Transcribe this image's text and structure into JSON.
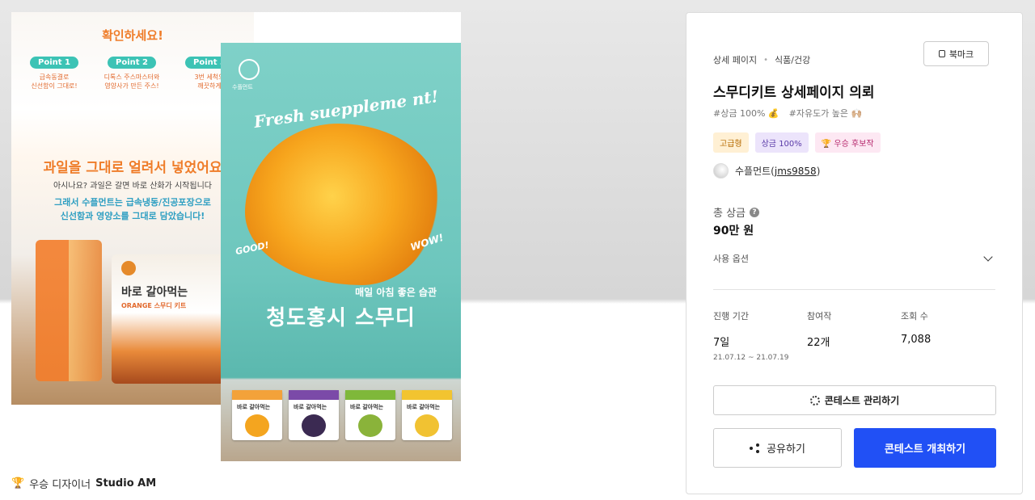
{
  "preview": {
    "image1": {
      "heading": "확인하세요!",
      "points": [
        {
          "label": "Point 1",
          "text": "급속동결로\n신선함이 그대로!"
        },
        {
          "label": "Point 2",
          "text": "디톡스 주스마스터와\n영양사가 만든 주스!"
        },
        {
          "label": "Point 3",
          "text": "3번 세척으\n깨끗하게"
        }
      ],
      "headline": "과일을 그대로 얼려서 넣었어요",
      "line1": "아시나요? 과일은 갈면 바로 산화가 시작됩니다",
      "line2": "그래서 수플먼트는 급속냉동/진공포장으로",
      "line3": "신선함과 영양소를 그대로 담았습니다!",
      "pack_title": "바로 갈아먹는",
      "pack_sub": "ORANGE 스무디 키트"
    },
    "image2": {
      "brand": "수플먼트",
      "script": "Fresh sueppleme nt!",
      "good": "GOOD!",
      "wow": "WOW!",
      "subtitle": "매일 아침 좋은 습관",
      "title": "청도홍시 스무디",
      "box_label": "바로 갈아먹는"
    }
  },
  "caption": {
    "prefix": "우승 디자이너",
    "name": "Studio AM"
  },
  "panel": {
    "breadcrumb": [
      "상세 페이지",
      "식품/건강"
    ],
    "bookmark_label": "북마크",
    "title": "스무디키트 상세페이지 의뢰",
    "tags": [
      "#상금 100% 💰",
      "#자유도가 높은 🙌🏼"
    ],
    "badges": [
      "고급형",
      "상금 100%",
      "🏆 우승 후보작"
    ],
    "author_name": "수플먼트",
    "author_id": "jms9858",
    "prize_label": "총 상금",
    "prize_value": "90만 원",
    "options_label": "사용 옵션",
    "stats": [
      {
        "label": "진행 기간",
        "value": "7일",
        "sub": "21.07.12 ~ 21.07.19"
      },
      {
        "label": "참여작",
        "value": "22개",
        "sub": ""
      },
      {
        "label": "조회 수",
        "value": "7,088",
        "sub": ""
      }
    ],
    "manage_label": "콘테스트 관리하기",
    "share_label": "공유하기",
    "open_label": "콘테스트 개최하기"
  },
  "colors": {
    "primary": "#2150f5",
    "accent_orange": "#ef7d2a",
    "teal": "#6dc6bd"
  }
}
